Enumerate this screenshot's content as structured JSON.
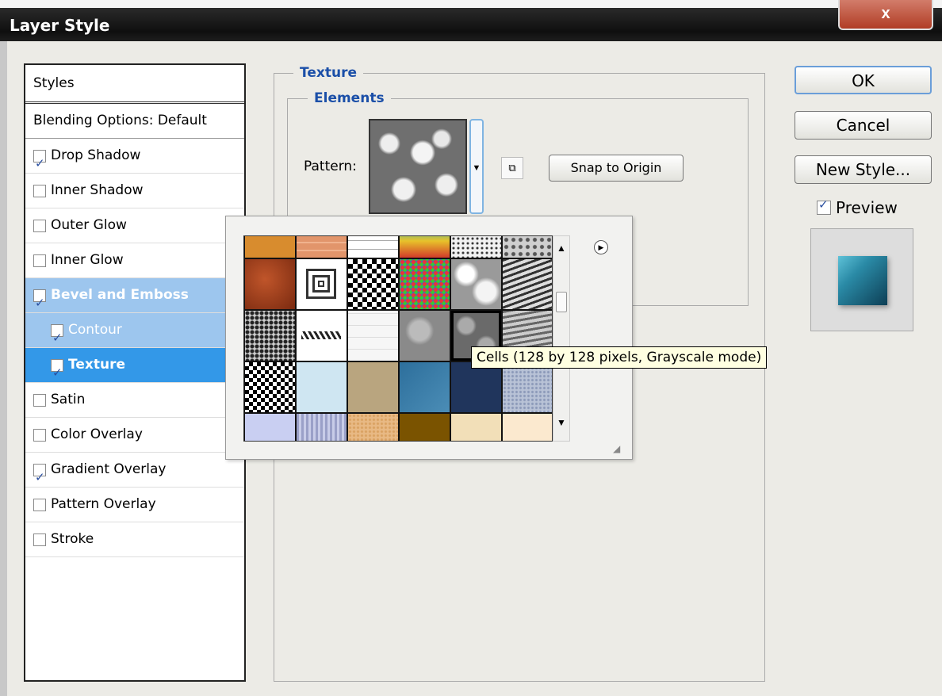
{
  "window": {
    "title": "Layer Style",
    "close_label": "x"
  },
  "styles_panel": {
    "header": "Styles",
    "blending": "Blending Options: Default",
    "items": [
      {
        "label": "Drop Shadow",
        "checked": true,
        "state": "normal"
      },
      {
        "label": "Inner Shadow",
        "checked": false,
        "state": "normal"
      },
      {
        "label": "Outer Glow",
        "checked": false,
        "state": "normal"
      },
      {
        "label": "Inner Glow",
        "checked": false,
        "state": "normal"
      },
      {
        "label": "Bevel and Emboss",
        "checked": true,
        "state": "selected-light"
      },
      {
        "label": "Contour",
        "checked": true,
        "state": "selected-mid"
      },
      {
        "label": "Texture",
        "checked": true,
        "state": "selected-dark"
      },
      {
        "label": "Satin",
        "checked": false,
        "state": "normal"
      },
      {
        "label": "Color Overlay",
        "checked": false,
        "state": "normal"
      },
      {
        "label": "Gradient Overlay",
        "checked": true,
        "state": "normal"
      },
      {
        "label": "Pattern Overlay",
        "checked": false,
        "state": "normal"
      },
      {
        "label": "Stroke",
        "checked": false,
        "state": "normal"
      }
    ]
  },
  "texture": {
    "section_title": "Texture",
    "elements_title": "Elements",
    "pattern_label": "Pattern:",
    "snap_button": "Snap to Origin"
  },
  "buttons": {
    "ok": "OK",
    "cancel": "Cancel",
    "new_style": "New Style..."
  },
  "preview": {
    "label": "Preview",
    "checked": true
  },
  "picker": {
    "tooltip": "Cells (128 by 128 pixels, Grayscale mode)",
    "selected_pattern": "Cells",
    "patterns": [
      "orange",
      "orange-tiles",
      "white-grid",
      "rainbow",
      "speckle",
      "gray-noise",
      "rust",
      "squares-nested",
      "checker",
      "colorful-noise",
      "clouds",
      "waves",
      "gravel",
      "chevrons",
      "white-bricks",
      "gray-clouds",
      "cells",
      "gray-waves",
      "checker-small",
      "light-blue",
      "tan",
      "blue-texture",
      "dark-blue",
      "gray-blue",
      "lavender",
      "stripes",
      "peach",
      "brown",
      "cream",
      "light-cream"
    ]
  }
}
